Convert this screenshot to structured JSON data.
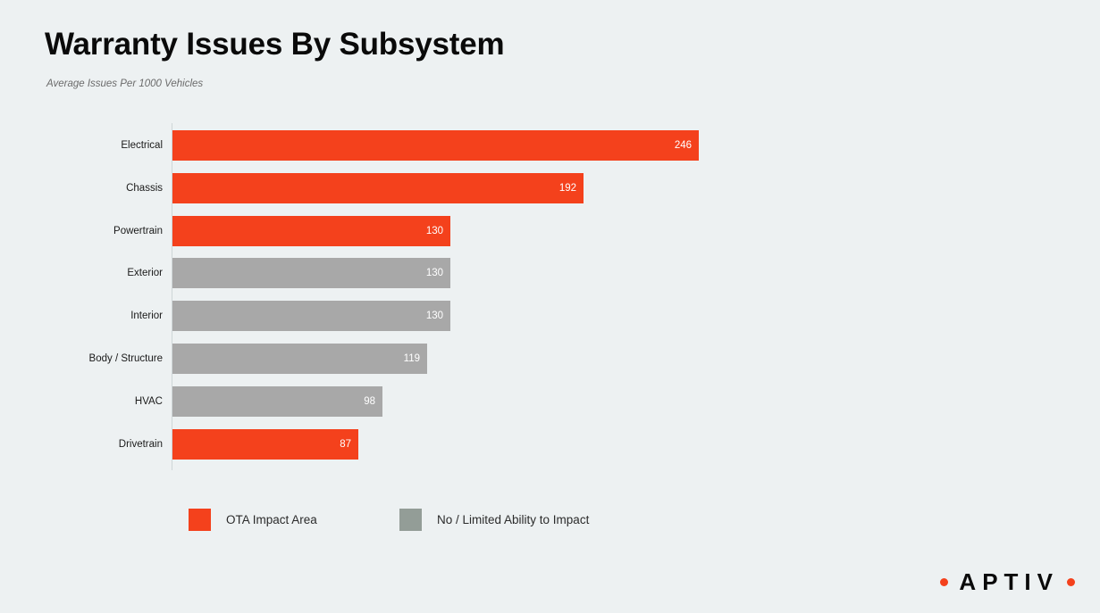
{
  "chart_data": {
    "type": "bar",
    "orientation": "horizontal",
    "title": "Warranty Issues By Subsystem",
    "subtitle": "Average Issues Per 1000 Vehicles",
    "xlabel": "",
    "ylabel": "",
    "xlim": [
      0,
      246
    ],
    "grid": false,
    "categories": [
      "Electrical",
      "Chassis",
      "Powertrain",
      "Exterior",
      "Interior",
      "Body / Structure",
      "HVAC",
      "Drivetrain"
    ],
    "values": [
      246,
      192,
      130,
      130,
      130,
      119,
      98,
      87
    ],
    "bar_groups": [
      "OTA Impact Area",
      "OTA Impact Area",
      "OTA Impact Area",
      "No / Limited Ability to Impact",
      "No / Limited Ability to Impact",
      "No / Limited Ability to Impact",
      "No / Limited Ability to Impact",
      "OTA Impact Area"
    ],
    "bars": [
      {
        "category": "Electrical",
        "value": 246,
        "group": "OTA Impact Area",
        "color": "#f4411c"
      },
      {
        "category": "Chassis",
        "value": 192,
        "group": "OTA Impact Area",
        "color": "#f4411c"
      },
      {
        "category": "Powertrain",
        "value": 130,
        "group": "OTA Impact Area",
        "color": "#f4411c"
      },
      {
        "category": "Exterior",
        "value": 130,
        "group": "No / Limited Ability to Impact",
        "color": "#a8a8a8"
      },
      {
        "category": "Interior",
        "value": 130,
        "group": "No / Limited Ability to Impact",
        "color": "#a8a8a8"
      },
      {
        "category": "Body / Structure",
        "value": 119,
        "group": "No / Limited Ability to Impact",
        "color": "#a8a8a8"
      },
      {
        "category": "HVAC",
        "value": 98,
        "group": "No / Limited Ability to Impact",
        "color": "#a8a8a8"
      },
      {
        "category": "Drivetrain",
        "value": 87,
        "group": "OTA Impact Area",
        "color": "#f4411c"
      }
    ],
    "legend": {
      "position": "bottom-left",
      "entries": [
        {
          "label": "OTA Impact Area",
          "color": "#f4411c"
        },
        {
          "label": "No / Limited Ability to Impact",
          "color": "#939d97"
        }
      ]
    }
  },
  "brand": {
    "wordmark": "APTIV",
    "dot_color": "#f4411c"
  },
  "theme": {
    "background": "#edf1f2",
    "accent": "#f4411c",
    "neutral_bar": "#a8a8a8",
    "axis_line": "#cfd6d8",
    "title_color": "#0a0a0a",
    "subtitle_color": "#6b6b6b"
  }
}
